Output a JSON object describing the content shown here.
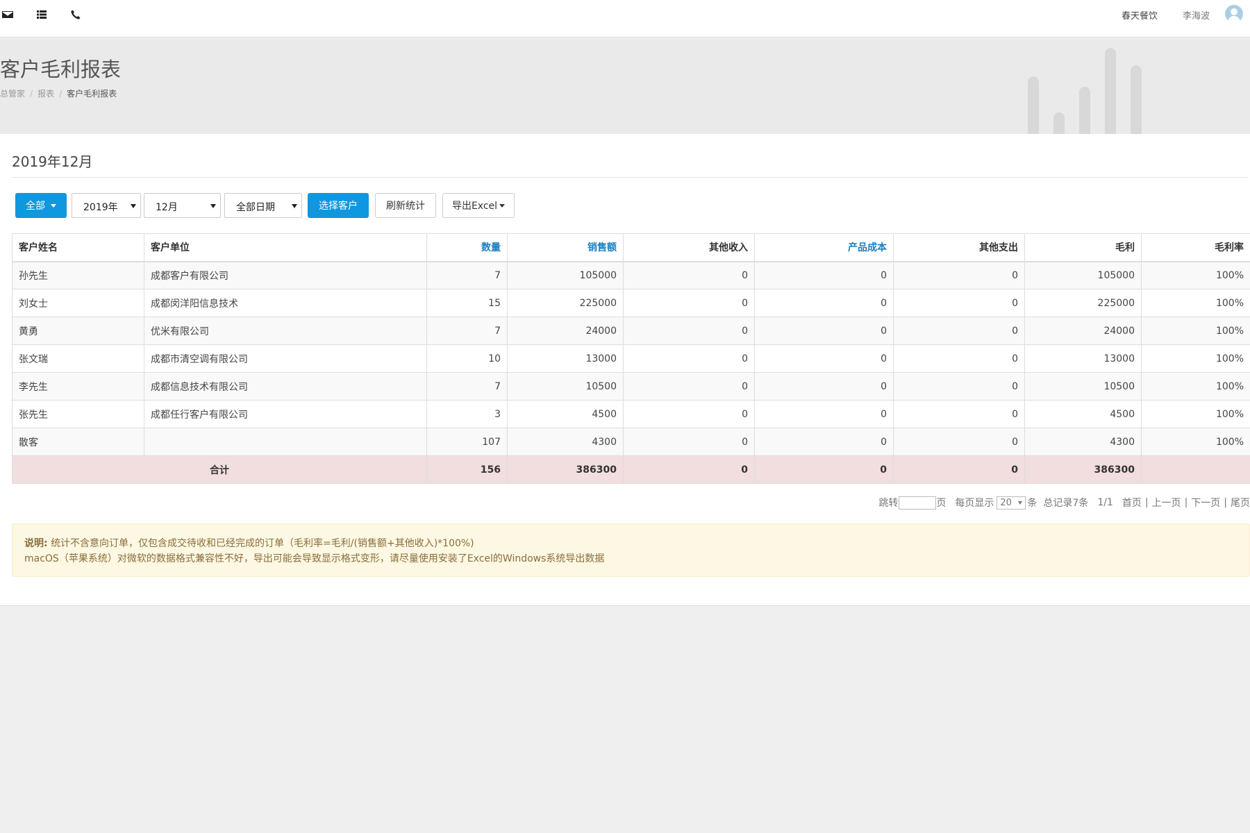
{
  "topbar": {
    "icons": [
      "envelope-icon",
      "list-icon",
      "phone-icon"
    ],
    "shop_name": "春天餐饮",
    "user_name": "李海波"
  },
  "header": {
    "title": "客户毛利报表",
    "breadcrumb": [
      "总管家",
      "报表",
      "客户毛利报表"
    ]
  },
  "period_title": "2019年12月",
  "filters": {
    "scope_button": "全部",
    "year_select": "2019年",
    "month_select": "12月",
    "date_select": "全部日期",
    "select_customer": "选择客户",
    "refresh": "刷新统计",
    "export": "导出Excel"
  },
  "table": {
    "headers": [
      "客户姓名",
      "客户单位",
      "数量",
      "销售额",
      "其他收入",
      "产品成本",
      "其他支出",
      "毛利",
      "毛利率"
    ],
    "rows": [
      [
        "孙先生",
        "成都客户有限公司",
        "7",
        "105000",
        "0",
        "0",
        "0",
        "105000",
        "100%"
      ],
      [
        "刘女士",
        "成都闵洋阳信息技术",
        "15",
        "225000",
        "0",
        "0",
        "0",
        "225000",
        "100%"
      ],
      [
        "黄勇",
        "优米有限公司",
        "7",
        "24000",
        "0",
        "0",
        "0",
        "24000",
        "100%"
      ],
      [
        "张文瑞",
        "成都市清空调有限公司",
        "10",
        "13000",
        "0",
        "0",
        "0",
        "13000",
        "100%"
      ],
      [
        "李先生",
        "成都信息技术有限公司",
        "7",
        "10500",
        "0",
        "0",
        "0",
        "10500",
        "100%"
      ],
      [
        "张先生",
        "成都任行客户有限公司",
        "3",
        "4500",
        "0",
        "0",
        "0",
        "4500",
        "100%"
      ],
      [
        "散客",
        "",
        "107",
        "4300",
        "0",
        "0",
        "0",
        "4300",
        "100%"
      ]
    ],
    "total": {
      "label": "合计",
      "quantity": "156",
      "sales": "386300",
      "other_income": "0",
      "product_cost": "0",
      "other_expense": "0",
      "gross_profit": "386300",
      "margin": ""
    }
  },
  "pager": {
    "jump_label": "跳转",
    "page_unit": "页",
    "per_page_label": "每页显示",
    "per_page": "20",
    "per_page_unit": "条",
    "total_records": "总记录7条",
    "page_info": "1/1",
    "first": "首页",
    "prev": "上一页",
    "next": "下一页",
    "last": "尾页"
  },
  "note": {
    "title": "说明:",
    "line1": "统计不含意向订单，仅包含成交待收和已经完成的订单（毛利率=毛利/(销售额+其他收入)*100%)",
    "line2": "macOS（苹果系统）对微软的数据格式兼容性不好，导出可能会导致显示格式变形，请尽量使用安装了Excel的Windows系统导出数据"
  },
  "colors": {
    "primary": "#0f97e0",
    "link": "#1a7fc1",
    "total_row_bg": "#f2dede",
    "note_bg": "#fcf8e3",
    "note_text": "#8a6d3b"
  }
}
